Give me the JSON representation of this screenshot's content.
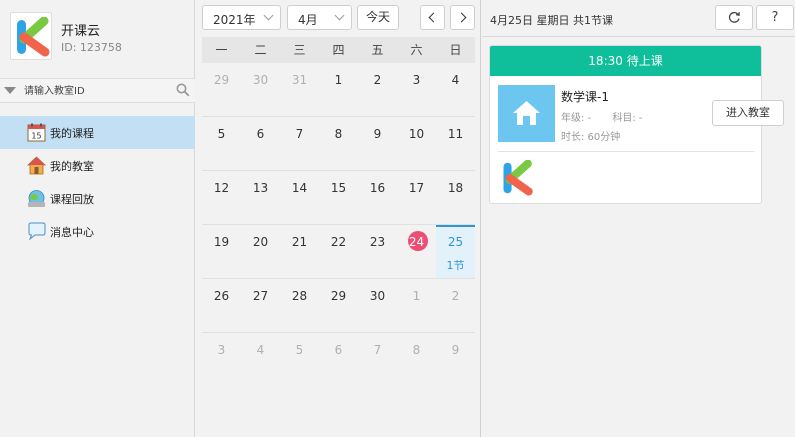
{
  "profile": {
    "name": "开课云",
    "id_text": "ID: 123758",
    "logo_icon": "kaikeyun-logo"
  },
  "search": {
    "placeholder": "请输入教室ID"
  },
  "nav": {
    "items": [
      {
        "label": "我的课程",
        "icon": "calendar-icon",
        "active": true
      },
      {
        "label": "我的教室",
        "icon": "house-icon",
        "active": false
      },
      {
        "label": "课程回放",
        "icon": "playback-icon",
        "active": false
      },
      {
        "label": "消息中心",
        "icon": "message-icon",
        "active": false
      }
    ],
    "calendar_icon_day": "15"
  },
  "calendar": {
    "year_label": "2021年",
    "month_label": "4月",
    "today_label": "今天",
    "weekdays": [
      "一",
      "二",
      "三",
      "四",
      "五",
      "六",
      "日"
    ],
    "weeks": [
      [
        "29",
        "30",
        "31",
        "1",
        "2",
        "3",
        "4"
      ],
      [
        "5",
        "6",
        "7",
        "8",
        "9",
        "10",
        "11"
      ],
      [
        "12",
        "13",
        "14",
        "15",
        "16",
        "17",
        "18"
      ],
      [
        "19",
        "20",
        "21",
        "22",
        "23",
        "24",
        "25"
      ],
      [
        "26",
        "27",
        "28",
        "29",
        "30",
        "1",
        "2"
      ],
      [
        "3",
        "4",
        "5",
        "6",
        "7",
        "8",
        "9"
      ]
    ],
    "today_day": "24",
    "selected_day": "25",
    "selected_count": "1节"
  },
  "panel": {
    "title": "4月25日 星期日 共1节课",
    "refresh_icon": "refresh-icon",
    "help_label": "?"
  },
  "lesson": {
    "header": "18:30  待上课",
    "name": "数学课-1",
    "grade": "年级: -",
    "subject": "科目: -",
    "duration": "时长: 60分钟",
    "enter_label": "进入教室"
  },
  "colors": {
    "accent": "#0fbf9b",
    "today": "#ee4e74",
    "selected": "#2e96d6",
    "nav_active": "#c2dff3"
  }
}
